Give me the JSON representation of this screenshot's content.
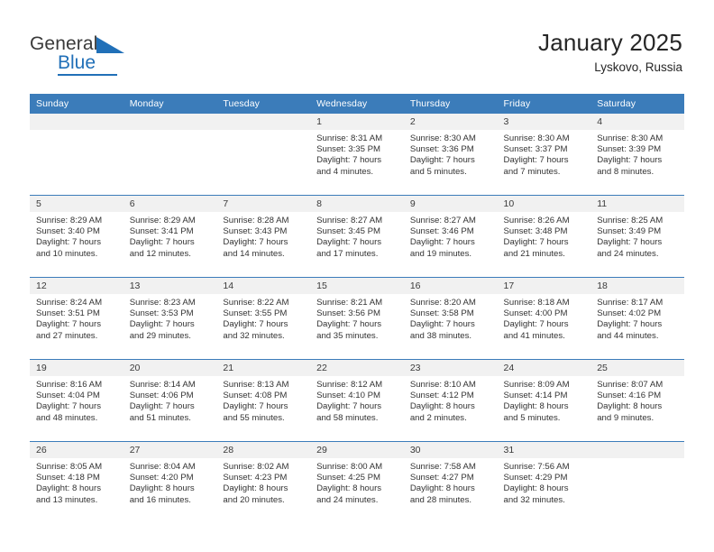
{
  "brand": {
    "name_part1": "General",
    "name_part2": "Blue"
  },
  "header": {
    "title": "January 2025",
    "location": "Lyskovo, Russia"
  },
  "colors": {
    "header_blue": "#3b7cba",
    "brand_blue": "#2170b8",
    "daynum_band": "#f1f1f1",
    "text": "#333333"
  },
  "weekday_headers": [
    "Sunday",
    "Monday",
    "Tuesday",
    "Wednesday",
    "Thursday",
    "Friday",
    "Saturday"
  ],
  "weeks": [
    [
      {
        "day": "",
        "sunrise": "",
        "sunset": "",
        "daylight_line1": "",
        "daylight_line2": "",
        "empty": true
      },
      {
        "day": "",
        "sunrise": "",
        "sunset": "",
        "daylight_line1": "",
        "daylight_line2": "",
        "empty": true
      },
      {
        "day": "",
        "sunrise": "",
        "sunset": "",
        "daylight_line1": "",
        "daylight_line2": "",
        "empty": true
      },
      {
        "day": "1",
        "sunrise": "Sunrise: 8:31 AM",
        "sunset": "Sunset: 3:35 PM",
        "daylight_line1": "Daylight: 7 hours",
        "daylight_line2": "and 4 minutes.",
        "empty": false
      },
      {
        "day": "2",
        "sunrise": "Sunrise: 8:30 AM",
        "sunset": "Sunset: 3:36 PM",
        "daylight_line1": "Daylight: 7 hours",
        "daylight_line2": "and 5 minutes.",
        "empty": false
      },
      {
        "day": "3",
        "sunrise": "Sunrise: 8:30 AM",
        "sunset": "Sunset: 3:37 PM",
        "daylight_line1": "Daylight: 7 hours",
        "daylight_line2": "and 7 minutes.",
        "empty": false
      },
      {
        "day": "4",
        "sunrise": "Sunrise: 8:30 AM",
        "sunset": "Sunset: 3:39 PM",
        "daylight_line1": "Daylight: 7 hours",
        "daylight_line2": "and 8 minutes.",
        "empty": false
      }
    ],
    [
      {
        "day": "5",
        "sunrise": "Sunrise: 8:29 AM",
        "sunset": "Sunset: 3:40 PM",
        "daylight_line1": "Daylight: 7 hours",
        "daylight_line2": "and 10 minutes.",
        "empty": false
      },
      {
        "day": "6",
        "sunrise": "Sunrise: 8:29 AM",
        "sunset": "Sunset: 3:41 PM",
        "daylight_line1": "Daylight: 7 hours",
        "daylight_line2": "and 12 minutes.",
        "empty": false
      },
      {
        "day": "7",
        "sunrise": "Sunrise: 8:28 AM",
        "sunset": "Sunset: 3:43 PM",
        "daylight_line1": "Daylight: 7 hours",
        "daylight_line2": "and 14 minutes.",
        "empty": false
      },
      {
        "day": "8",
        "sunrise": "Sunrise: 8:27 AM",
        "sunset": "Sunset: 3:45 PM",
        "daylight_line1": "Daylight: 7 hours",
        "daylight_line2": "and 17 minutes.",
        "empty": false
      },
      {
        "day": "9",
        "sunrise": "Sunrise: 8:27 AM",
        "sunset": "Sunset: 3:46 PM",
        "daylight_line1": "Daylight: 7 hours",
        "daylight_line2": "and 19 minutes.",
        "empty": false
      },
      {
        "day": "10",
        "sunrise": "Sunrise: 8:26 AM",
        "sunset": "Sunset: 3:48 PM",
        "daylight_line1": "Daylight: 7 hours",
        "daylight_line2": "and 21 minutes.",
        "empty": false
      },
      {
        "day": "11",
        "sunrise": "Sunrise: 8:25 AM",
        "sunset": "Sunset: 3:49 PM",
        "daylight_line1": "Daylight: 7 hours",
        "daylight_line2": "and 24 minutes.",
        "empty": false
      }
    ],
    [
      {
        "day": "12",
        "sunrise": "Sunrise: 8:24 AM",
        "sunset": "Sunset: 3:51 PM",
        "daylight_line1": "Daylight: 7 hours",
        "daylight_line2": "and 27 minutes.",
        "empty": false
      },
      {
        "day": "13",
        "sunrise": "Sunrise: 8:23 AM",
        "sunset": "Sunset: 3:53 PM",
        "daylight_line1": "Daylight: 7 hours",
        "daylight_line2": "and 29 minutes.",
        "empty": false
      },
      {
        "day": "14",
        "sunrise": "Sunrise: 8:22 AM",
        "sunset": "Sunset: 3:55 PM",
        "daylight_line1": "Daylight: 7 hours",
        "daylight_line2": "and 32 minutes.",
        "empty": false
      },
      {
        "day": "15",
        "sunrise": "Sunrise: 8:21 AM",
        "sunset": "Sunset: 3:56 PM",
        "daylight_line1": "Daylight: 7 hours",
        "daylight_line2": "and 35 minutes.",
        "empty": false
      },
      {
        "day": "16",
        "sunrise": "Sunrise: 8:20 AM",
        "sunset": "Sunset: 3:58 PM",
        "daylight_line1": "Daylight: 7 hours",
        "daylight_line2": "and 38 minutes.",
        "empty": false
      },
      {
        "day": "17",
        "sunrise": "Sunrise: 8:18 AM",
        "sunset": "Sunset: 4:00 PM",
        "daylight_line1": "Daylight: 7 hours",
        "daylight_line2": "and 41 minutes.",
        "empty": false
      },
      {
        "day": "18",
        "sunrise": "Sunrise: 8:17 AM",
        "sunset": "Sunset: 4:02 PM",
        "daylight_line1": "Daylight: 7 hours",
        "daylight_line2": "and 44 minutes.",
        "empty": false
      }
    ],
    [
      {
        "day": "19",
        "sunrise": "Sunrise: 8:16 AM",
        "sunset": "Sunset: 4:04 PM",
        "daylight_line1": "Daylight: 7 hours",
        "daylight_line2": "and 48 minutes.",
        "empty": false
      },
      {
        "day": "20",
        "sunrise": "Sunrise: 8:14 AM",
        "sunset": "Sunset: 4:06 PM",
        "daylight_line1": "Daylight: 7 hours",
        "daylight_line2": "and 51 minutes.",
        "empty": false
      },
      {
        "day": "21",
        "sunrise": "Sunrise: 8:13 AM",
        "sunset": "Sunset: 4:08 PM",
        "daylight_line1": "Daylight: 7 hours",
        "daylight_line2": "and 55 minutes.",
        "empty": false
      },
      {
        "day": "22",
        "sunrise": "Sunrise: 8:12 AM",
        "sunset": "Sunset: 4:10 PM",
        "daylight_line1": "Daylight: 7 hours",
        "daylight_line2": "and 58 minutes.",
        "empty": false
      },
      {
        "day": "23",
        "sunrise": "Sunrise: 8:10 AM",
        "sunset": "Sunset: 4:12 PM",
        "daylight_line1": "Daylight: 8 hours",
        "daylight_line2": "and 2 minutes.",
        "empty": false
      },
      {
        "day": "24",
        "sunrise": "Sunrise: 8:09 AM",
        "sunset": "Sunset: 4:14 PM",
        "daylight_line1": "Daylight: 8 hours",
        "daylight_line2": "and 5 minutes.",
        "empty": false
      },
      {
        "day": "25",
        "sunrise": "Sunrise: 8:07 AM",
        "sunset": "Sunset: 4:16 PM",
        "daylight_line1": "Daylight: 8 hours",
        "daylight_line2": "and 9 minutes.",
        "empty": false
      }
    ],
    [
      {
        "day": "26",
        "sunrise": "Sunrise: 8:05 AM",
        "sunset": "Sunset: 4:18 PM",
        "daylight_line1": "Daylight: 8 hours",
        "daylight_line2": "and 13 minutes.",
        "empty": false
      },
      {
        "day": "27",
        "sunrise": "Sunrise: 8:04 AM",
        "sunset": "Sunset: 4:20 PM",
        "daylight_line1": "Daylight: 8 hours",
        "daylight_line2": "and 16 minutes.",
        "empty": false
      },
      {
        "day": "28",
        "sunrise": "Sunrise: 8:02 AM",
        "sunset": "Sunset: 4:23 PM",
        "daylight_line1": "Daylight: 8 hours",
        "daylight_line2": "and 20 minutes.",
        "empty": false
      },
      {
        "day": "29",
        "sunrise": "Sunrise: 8:00 AM",
        "sunset": "Sunset: 4:25 PM",
        "daylight_line1": "Daylight: 8 hours",
        "daylight_line2": "and 24 minutes.",
        "empty": false
      },
      {
        "day": "30",
        "sunrise": "Sunrise: 7:58 AM",
        "sunset": "Sunset: 4:27 PM",
        "daylight_line1": "Daylight: 8 hours",
        "daylight_line2": "and 28 minutes.",
        "empty": false
      },
      {
        "day": "31",
        "sunrise": "Sunrise: 7:56 AM",
        "sunset": "Sunset: 4:29 PM",
        "daylight_line1": "Daylight: 8 hours",
        "daylight_line2": "and 32 minutes.",
        "empty": false
      },
      {
        "day": "",
        "sunrise": "",
        "sunset": "",
        "daylight_line1": "",
        "daylight_line2": "",
        "empty": true
      }
    ]
  ]
}
